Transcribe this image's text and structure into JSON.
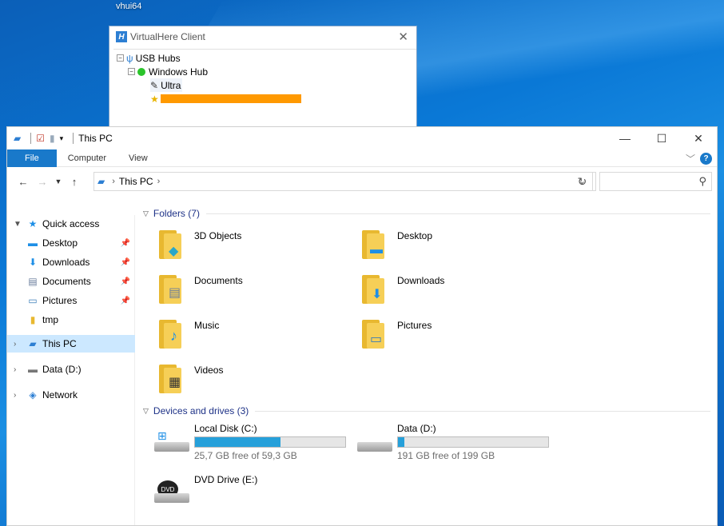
{
  "desktop": {
    "label": "vhui64"
  },
  "virtualhere": {
    "title": "VirtualHere Client",
    "tree": {
      "root_label": "USB Hubs",
      "hub_label": "Windows Hub",
      "device_label": "Ultra"
    }
  },
  "explorer": {
    "title": "This PC",
    "ribbon_tabs": [
      "File",
      "Computer",
      "View"
    ],
    "address": {
      "location": "This PC"
    },
    "search": {
      "placeholder": ""
    },
    "sidebar": {
      "quick_access": "Quick access",
      "items": [
        {
          "label": "Desktop",
          "icon": "desktop-icon",
          "pinned": true
        },
        {
          "label": "Downloads",
          "icon": "download-icon",
          "pinned": true
        },
        {
          "label": "Documents",
          "icon": "documents-icon",
          "pinned": true
        },
        {
          "label": "Pictures",
          "icon": "pictures-icon",
          "pinned": true
        },
        {
          "label": "tmp",
          "icon": "folder-icon",
          "pinned": false
        }
      ],
      "this_pc": "This PC",
      "data_drive": "Data (D:)",
      "network": "Network"
    },
    "folders_group": "Folders (7)",
    "folders": [
      {
        "label": "3D Objects",
        "icon": "3d-objects-icon"
      },
      {
        "label": "Desktop",
        "icon": "desktop-folder-icon"
      },
      {
        "label": "Documents",
        "icon": "documents-folder-icon"
      },
      {
        "label": "Downloads",
        "icon": "downloads-folder-icon"
      },
      {
        "label": "Music",
        "icon": "music-folder-icon"
      },
      {
        "label": "Pictures",
        "icon": "pictures-folder-icon"
      },
      {
        "label": "Videos",
        "icon": "videos-folder-icon"
      }
    ],
    "drives_group": "Devices and drives (3)",
    "drives": [
      {
        "label": "Local Disk (C:)",
        "free": "25,7 GB free of 59,3 GB",
        "used_fraction": 0.57
      },
      {
        "label": "Data (D:)",
        "free": "191 GB free of 199 GB",
        "used_fraction": 0.04
      },
      {
        "label": "DVD Drive (E:)",
        "dvd_text": "DVD"
      }
    ]
  }
}
